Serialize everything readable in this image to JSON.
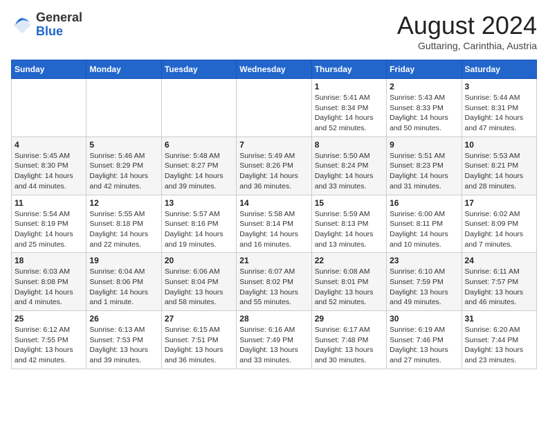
{
  "header": {
    "logo": {
      "general": "General",
      "blue": "Blue"
    },
    "title": "August 2024",
    "location": "Guttaring, Carinthia, Austria"
  },
  "calendar": {
    "days_of_week": [
      "Sunday",
      "Monday",
      "Tuesday",
      "Wednesday",
      "Thursday",
      "Friday",
      "Saturday"
    ],
    "weeks": [
      [
        {
          "day": "",
          "info": ""
        },
        {
          "day": "",
          "info": ""
        },
        {
          "day": "",
          "info": ""
        },
        {
          "day": "",
          "info": ""
        },
        {
          "day": "1",
          "info": "Sunrise: 5:41 AM\nSunset: 8:34 PM\nDaylight: 14 hours\nand 52 minutes."
        },
        {
          "day": "2",
          "info": "Sunrise: 5:43 AM\nSunset: 8:33 PM\nDaylight: 14 hours\nand 50 minutes."
        },
        {
          "day": "3",
          "info": "Sunrise: 5:44 AM\nSunset: 8:31 PM\nDaylight: 14 hours\nand 47 minutes."
        }
      ],
      [
        {
          "day": "4",
          "info": "Sunrise: 5:45 AM\nSunset: 8:30 PM\nDaylight: 14 hours\nand 44 minutes."
        },
        {
          "day": "5",
          "info": "Sunrise: 5:46 AM\nSunset: 8:29 PM\nDaylight: 14 hours\nand 42 minutes."
        },
        {
          "day": "6",
          "info": "Sunrise: 5:48 AM\nSunset: 8:27 PM\nDaylight: 14 hours\nand 39 minutes."
        },
        {
          "day": "7",
          "info": "Sunrise: 5:49 AM\nSunset: 8:26 PM\nDaylight: 14 hours\nand 36 minutes."
        },
        {
          "day": "8",
          "info": "Sunrise: 5:50 AM\nSunset: 8:24 PM\nDaylight: 14 hours\nand 33 minutes."
        },
        {
          "day": "9",
          "info": "Sunrise: 5:51 AM\nSunset: 8:23 PM\nDaylight: 14 hours\nand 31 minutes."
        },
        {
          "day": "10",
          "info": "Sunrise: 5:53 AM\nSunset: 8:21 PM\nDaylight: 14 hours\nand 28 minutes."
        }
      ],
      [
        {
          "day": "11",
          "info": "Sunrise: 5:54 AM\nSunset: 8:19 PM\nDaylight: 14 hours\nand 25 minutes."
        },
        {
          "day": "12",
          "info": "Sunrise: 5:55 AM\nSunset: 8:18 PM\nDaylight: 14 hours\nand 22 minutes."
        },
        {
          "day": "13",
          "info": "Sunrise: 5:57 AM\nSunset: 8:16 PM\nDaylight: 14 hours\nand 19 minutes."
        },
        {
          "day": "14",
          "info": "Sunrise: 5:58 AM\nSunset: 8:14 PM\nDaylight: 14 hours\nand 16 minutes."
        },
        {
          "day": "15",
          "info": "Sunrise: 5:59 AM\nSunset: 8:13 PM\nDaylight: 14 hours\nand 13 minutes."
        },
        {
          "day": "16",
          "info": "Sunrise: 6:00 AM\nSunset: 8:11 PM\nDaylight: 14 hours\nand 10 minutes."
        },
        {
          "day": "17",
          "info": "Sunrise: 6:02 AM\nSunset: 8:09 PM\nDaylight: 14 hours\nand 7 minutes."
        }
      ],
      [
        {
          "day": "18",
          "info": "Sunrise: 6:03 AM\nSunset: 8:08 PM\nDaylight: 14 hours\nand 4 minutes."
        },
        {
          "day": "19",
          "info": "Sunrise: 6:04 AM\nSunset: 8:06 PM\nDaylight: 14 hours\nand 1 minute."
        },
        {
          "day": "20",
          "info": "Sunrise: 6:06 AM\nSunset: 8:04 PM\nDaylight: 13 hours\nand 58 minutes."
        },
        {
          "day": "21",
          "info": "Sunrise: 6:07 AM\nSunset: 8:02 PM\nDaylight: 13 hours\nand 55 minutes."
        },
        {
          "day": "22",
          "info": "Sunrise: 6:08 AM\nSunset: 8:01 PM\nDaylight: 13 hours\nand 52 minutes."
        },
        {
          "day": "23",
          "info": "Sunrise: 6:10 AM\nSunset: 7:59 PM\nDaylight: 13 hours\nand 49 minutes."
        },
        {
          "day": "24",
          "info": "Sunrise: 6:11 AM\nSunset: 7:57 PM\nDaylight: 13 hours\nand 46 minutes."
        }
      ],
      [
        {
          "day": "25",
          "info": "Sunrise: 6:12 AM\nSunset: 7:55 PM\nDaylight: 13 hours\nand 42 minutes."
        },
        {
          "day": "26",
          "info": "Sunrise: 6:13 AM\nSunset: 7:53 PM\nDaylight: 13 hours\nand 39 minutes."
        },
        {
          "day": "27",
          "info": "Sunrise: 6:15 AM\nSunset: 7:51 PM\nDaylight: 13 hours\nand 36 minutes."
        },
        {
          "day": "28",
          "info": "Sunrise: 6:16 AM\nSunset: 7:49 PM\nDaylight: 13 hours\nand 33 minutes."
        },
        {
          "day": "29",
          "info": "Sunrise: 6:17 AM\nSunset: 7:48 PM\nDaylight: 13 hours\nand 30 minutes."
        },
        {
          "day": "30",
          "info": "Sunrise: 6:19 AM\nSunset: 7:46 PM\nDaylight: 13 hours\nand 27 minutes."
        },
        {
          "day": "31",
          "info": "Sunrise: 6:20 AM\nSunset: 7:44 PM\nDaylight: 13 hours\nand 23 minutes."
        }
      ]
    ]
  }
}
